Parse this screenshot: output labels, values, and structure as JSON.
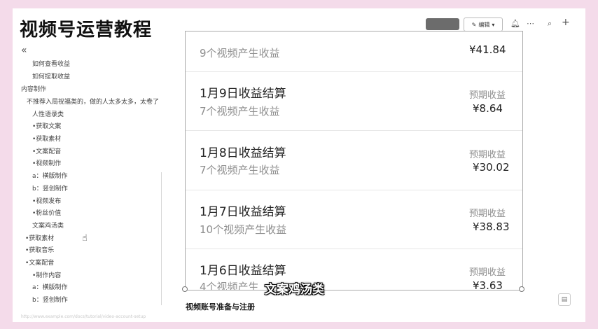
{
  "overlay_title": "视频号运营教程",
  "toc": [
    {
      "label": "如何查看收益"
    },
    {
      "label": "如何提取收益"
    },
    {
      "label": "内容制作"
    },
    {
      "label": "不推荐入局祝福类的，做的人太多太多，太卷了"
    },
    {
      "label": "人性语录类"
    },
    {
      "label": "•获取文案"
    },
    {
      "label": "•获取素材"
    },
    {
      "label": "•文案配音"
    },
    {
      "label": "•视频制作"
    },
    {
      "label": "a：横版制作"
    },
    {
      "label": "b：竖创制作"
    },
    {
      "label": "•视频发布"
    },
    {
      "label": "•粉丝价值"
    },
    {
      "label": "文案鸡汤类"
    },
    {
      "label": "•获取素材"
    },
    {
      "label": "•获取音乐"
    },
    {
      "label": "•文案配音"
    },
    {
      "label": "•制作内容"
    },
    {
      "label": "a：横版制作"
    },
    {
      "label": "b：竖创制作"
    }
  ],
  "toolbar": {
    "share_label": "",
    "edit_label": "编辑",
    "icons": [
      "pencil-icon",
      "chevron-down-icon",
      "bell-icon",
      "more-icon",
      "search-icon",
      "plus-icon"
    ]
  },
  "earnings": [
    {
      "title": "",
      "subtitle": "9个视频产生收益",
      "label": "预期收益",
      "amount": "¥41.84"
    },
    {
      "title": "1月9日收益结算",
      "subtitle": "7个视频产生收益",
      "label": "预期收益",
      "amount": "¥8.64"
    },
    {
      "title": "1月8日收益结算",
      "subtitle": "7个视频产生收益",
      "label": "预期收益",
      "amount": "¥30.02"
    },
    {
      "title": "1月7日收益结算",
      "subtitle": "10个视频产生收益",
      "label": "预期收益",
      "amount": "¥38.83"
    },
    {
      "title": "1月6日收益结算",
      "subtitle": "4个视频产生",
      "label": "预期收益",
      "amount": "¥3.63"
    }
  ],
  "caption": "文案鸡汤类",
  "section_heading": "视频账号准备与注册",
  "bottom_url": "http://www.example.com/docs/tutorial/video-account-setup"
}
